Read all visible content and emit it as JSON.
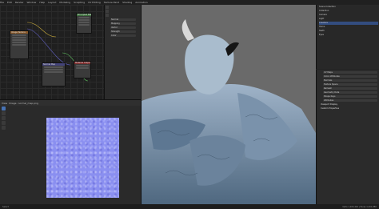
{
  "menu": [
    "File",
    "Edit",
    "Render",
    "Window",
    "Help",
    "Layout",
    "Modeling",
    "Sculpting",
    "UV Editing",
    "Texture Paint",
    "Shading",
    "Animation"
  ],
  "node_editor": {
    "nodes": [
      {
        "title": "Principled BSDF",
        "color": "#3b6e3b"
      },
      {
        "title": "Image Texture",
        "color": "#8a5a2a"
      },
      {
        "title": "Normal Map",
        "color": "#44447a"
      },
      {
        "title": "Material Output",
        "color": "#7a2a2a"
      }
    ]
  },
  "props_mid": [
    "Normal",
    "Mapping",
    "Vector",
    "Strength",
    "Color"
  ],
  "image_editor": {
    "header": [
      "View",
      "Image",
      "normal_map.png"
    ]
  },
  "outliner": [
    "Scene Collection",
    "Collection",
    "Camera",
    "Light",
    "Creature",
    "Horns",
    "Teeth",
    "Eyes"
  ],
  "props_right": {
    "sections": [
      "Viewport Display",
      "Custom Properties"
    ],
    "lines": [
      "UV Maps",
      "Color Attributes",
      "Normals",
      "Texture Space",
      "Remesh",
      "Geometry Data",
      "Shape Keys",
      "Attributes"
    ]
  },
  "status": {
    "left": "Select",
    "right": "Verts 1,203,442 | Faces 1,201,880"
  }
}
